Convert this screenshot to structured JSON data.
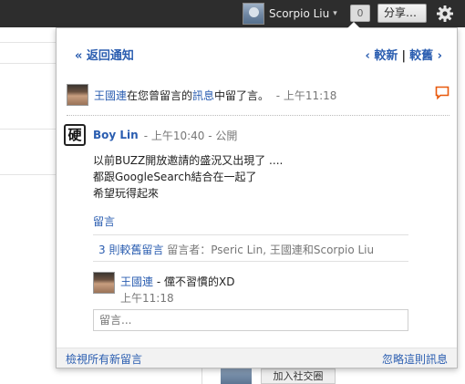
{
  "topbar": {
    "user_name": "Scorpio Liu",
    "caret": "▾",
    "notification_count": "0",
    "share_label": "分享…",
    "icons": {
      "avatar": "user-avatar",
      "settings": "gear-icon"
    }
  },
  "background": {
    "join_label": "加入社交圈"
  },
  "nav": {
    "back_label": "« 返回通知",
    "newer_label": "‹ 較新",
    "separator": "|",
    "older_label": "較舊 ›"
  },
  "notification": {
    "actor": "王國連",
    "text_before_link": "在您曾留言的",
    "link_text": "訊息",
    "text_after_link": "中留了言。",
    "time": "- 上午11:18",
    "icon": "comment-flag-icon",
    "flag_color": "#e8590c"
  },
  "post": {
    "avatar_char": "硬",
    "author": "Boy Lin",
    "meta": "- 上午10:40 - 公開",
    "lines": [
      "以前BUZZ開放邀請的盛況又出現了 ....",
      "都跟GoogleSearch結合在一起了",
      "希望玩得起來"
    ],
    "comment_link": "留言"
  },
  "older_comments": {
    "count_label": "3 則較舊留言",
    "commenters_label": "留言者：Pseric Lin, 王國連和Scorpio Liu"
  },
  "reply": {
    "author": "王國連",
    "text": "- 儻不習慣的XD",
    "time": "上午11:18"
  },
  "comment_input": {
    "placeholder": "留言..."
  },
  "footer": {
    "view_all": "檢視所有新留言",
    "ignore": "忽略這則訊息"
  },
  "colors": {
    "link": "#2a5db0",
    "topbar": "#2d2d2d"
  }
}
